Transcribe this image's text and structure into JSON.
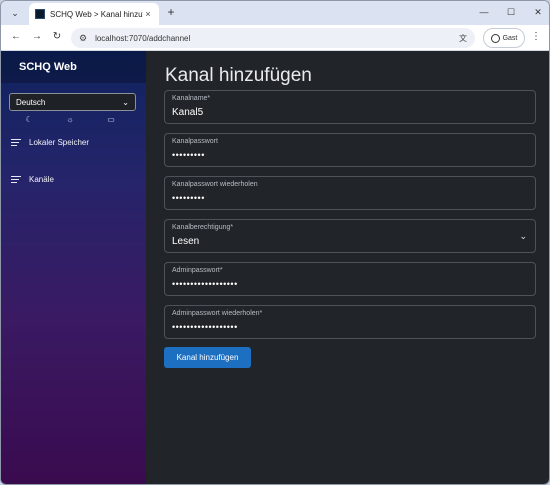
{
  "browser": {
    "tab_title": "SCHQ Web > Kanal hinzufügen",
    "tab_close": "×",
    "new_tab": "+",
    "url": "localhost:7070/addchannel",
    "profile_label": "Gast",
    "controls": {
      "minimize": "—",
      "maximize": "☐",
      "close": "✕"
    },
    "nav": {
      "back": "←",
      "forward": "→",
      "reload": "↻",
      "menu": "⋮",
      "tab_search": "⌄"
    }
  },
  "sidebar": {
    "brand": "SCHQ Web",
    "language": "Deutsch",
    "theme_icons": [
      "moon-icon",
      "sun-icon",
      "monitor-icon"
    ],
    "items": [
      {
        "label": "Lokaler Speicher"
      },
      {
        "label": "Kanäle"
      }
    ]
  },
  "main": {
    "title": "Kanal hinzufügen",
    "fields": [
      {
        "label": "Kanalname*",
        "value": "Kanal5",
        "type": "text"
      },
      {
        "label": "Kanalpasswort",
        "value": "•••••••••",
        "type": "password"
      },
      {
        "label": "Kanalpasswort wiederholen",
        "value": "•••••••••",
        "type": "password"
      },
      {
        "label": "Kanalberechtigung*",
        "value": "Lesen",
        "type": "select"
      },
      {
        "label": "Adminpasswort*",
        "value": "••••••••••••••••••",
        "type": "password"
      },
      {
        "label": "Adminpasswort wiederholen*",
        "value": "••••••••••••••••••",
        "type": "password"
      }
    ],
    "submit_label": "Kanal hinzufügen"
  },
  "colors": {
    "page_bg": "#212529",
    "accent": "#1d6fc2",
    "sidebar_top": "#0e2360",
    "sidebar_bottom": "#3a0a4e"
  }
}
